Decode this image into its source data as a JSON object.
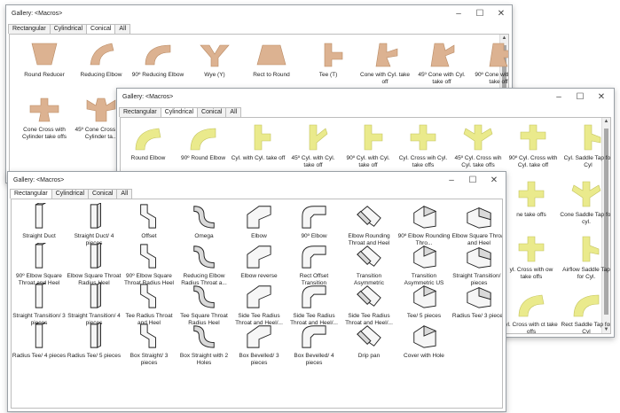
{
  "colors": {
    "conical": "#dcb291",
    "conical_dark": "#b98a63",
    "cylindrical": "#eaea8c",
    "cylindrical_dark": "#c3c35e",
    "accent_ink": "#222222"
  },
  "controls": {
    "minimize": "–",
    "maximize": "☐",
    "close": "✕",
    "scroll_up": "▲",
    "scroll_down": "▼"
  },
  "window1": {
    "title": "Gallery: <Macros>",
    "tabs": [
      "Rectangular",
      "Cylindrical",
      "Conical",
      "All"
    ],
    "active_tab": 2,
    "items": [
      {
        "label": "Round Reducer",
        "icon": "round-reducer-icon"
      },
      {
        "label": "Reducing Elbow",
        "icon": "reducing-elbow-icon"
      },
      {
        "label": "90º Reducing Elbow",
        "icon": "reducing-elbow-90-icon"
      },
      {
        "label": "Wye (Y)",
        "icon": "wye-icon"
      },
      {
        "label": "Rect to Round",
        "icon": "rect-to-round-icon"
      },
      {
        "label": "Tee (T)",
        "icon": "tee-icon"
      },
      {
        "label": "Cone with Cyl. take off",
        "icon": "cone-cyl-takeoff-icon"
      },
      {
        "label": "45º Cone with Cyl. take off",
        "icon": "cone-45-takeoff-icon"
      },
      {
        "label": "90º Cone with Cyl. take off",
        "icon": "cone-90-takeoff-icon"
      },
      {
        "label": "Cone Cross with Cylinder take offs",
        "icon": "cone-cross-icon"
      },
      {
        "label": "45º Cone Cross with Cylinder ta...",
        "icon": "cone-cross-45-icon"
      },
      {
        "label": "",
        "icon": "cone-partial-icon"
      },
      {
        "label": "",
        "icon": "cone-partial-icon"
      }
    ]
  },
  "window2": {
    "title": "Gallery: <Macros>",
    "tabs": [
      "Rectangular",
      "Cylindrical",
      "Conical",
      "All"
    ],
    "active_tab": 1,
    "items": [
      {
        "label": "Round Elbow",
        "icon": "round-elbow-icon"
      },
      {
        "label": "90º Round Elbow",
        "icon": "round-elbow-90-icon"
      },
      {
        "label": "Cyl. with Cyl. take off",
        "icon": "cyl-takeoff-icon"
      },
      {
        "label": "45º Cyl. with Cyl. take off",
        "icon": "cyl-45-takeoff-icon"
      },
      {
        "label": "90º Cyl. with Cyl. take off",
        "icon": "cyl-90-takeoff-icon"
      },
      {
        "label": "Cyl. Cross wih Cyl. take offs",
        "icon": "cyl-cross-icon"
      },
      {
        "label": "45º Cyl. Cross wih Cyl. take offs",
        "icon": "cyl-cross-45-icon"
      },
      {
        "label": "90º Cyl. Cross with Cyl. take off",
        "icon": "cyl-cross-90-icon"
      },
      {
        "label": "Cyl. Saddle Tap for Cyl",
        "icon": "saddle-tap-icon"
      }
    ],
    "side_items": [
      {
        "label": "ne take offs",
        "icon": "cyl-cross-side-icon"
      },
      {
        "label": "Cone Saddle Tap for cyl.",
        "icon": "cone-saddle-icon"
      },
      {
        "label": "yl. Cross with ow take offs",
        "icon": "cyl-cross-side2-icon"
      },
      {
        "label": "Airflow Saddle Tap for Cyl.",
        "icon": "airflow-saddle-icon"
      },
      {
        "label": "yl. Cross with ct take offs",
        "icon": "cyl-cross-side3-icon"
      },
      {
        "label": "Rect Saddle Tap for Cyl",
        "icon": "rect-saddle-icon"
      }
    ]
  },
  "window3": {
    "title": "Gallery: <Macros>",
    "tabs": [
      "Rectangular",
      "Cylindrical",
      "Conical",
      "All"
    ],
    "active_tab": 0,
    "items": [
      {
        "label": "Straight Duct",
        "icon": "straight-duct-icon"
      },
      {
        "label": "Straight Duct/ 4 pieces",
        "icon": "straight-duct-4-icon"
      },
      {
        "label": "Offset",
        "icon": "offset-icon"
      },
      {
        "label": "Omega",
        "icon": "omega-icon"
      },
      {
        "label": "Elbow",
        "icon": "elbow-icon"
      },
      {
        "label": "90º Elbow",
        "icon": "elbow-90-icon"
      },
      {
        "label": "Elbow Rounding Throat and Heel",
        "icon": "elbow-rounding-icon"
      },
      {
        "label": "90º Elbow Rounding Thro...",
        "icon": "elbow-rounding-90-icon"
      },
      {
        "label": "Elbow Square Throat and Heel",
        "icon": "elbow-square-icon"
      },
      {
        "label": "90º Elbow Square Throat and Heel",
        "icon": "elbow-square-90-icon"
      },
      {
        "label": "Elbow Square Throat Radius Heel",
        "icon": "elbow-square-radius-icon"
      },
      {
        "label": "90º Elbow Square Throat Radius Heel",
        "icon": "elbow-square-radius-90-icon"
      },
      {
        "label": "Reducing Elbow Radius Throat a...",
        "icon": "reducing-elbow-radius-icon"
      },
      {
        "label": "Elbow reverse",
        "icon": "elbow-reverse-icon"
      },
      {
        "label": "Rect Offset Transition",
        "icon": "rect-offset-transition-icon"
      },
      {
        "label": "Transition Asymmetric",
        "icon": "transition-asym-icon"
      },
      {
        "label": "Transition Asymmetric US",
        "icon": "transition-asym-us-icon"
      },
      {
        "label": "Straight Transition/ 2 pieces",
        "icon": "straight-transition-2-icon"
      },
      {
        "label": "Straight Transition/ 3 pieces",
        "icon": "straight-transition-3-icon"
      },
      {
        "label": "Straight Transition/ 4 pieces",
        "icon": "straight-transition-4-icon"
      },
      {
        "label": "Tee Radius Throat and Heel",
        "icon": "tee-radius-icon"
      },
      {
        "label": "Tee Square Throat Radius Heel",
        "icon": "tee-square-icon"
      },
      {
        "label": "Side Tee Radius Throat and Heel/...",
        "icon": "side-tee-radius-icon"
      },
      {
        "label": "Side Tee Radius Throat and Heel/...",
        "icon": "side-tee-radius-2-icon"
      },
      {
        "label": "Side Tee Radius Throat and Heel/...",
        "icon": "side-tee-radius-3-icon"
      },
      {
        "label": "Tee/ 5 pieces",
        "icon": "tee-5-icon"
      },
      {
        "label": "Radius Tee/ 3 pieces",
        "icon": "radius-tee-3-icon"
      },
      {
        "label": "Radius Tee/ 4 pieces",
        "icon": "radius-tee-4-icon"
      },
      {
        "label": "Radius Tee/ 5 pieces",
        "icon": "radius-tee-5-icon"
      },
      {
        "label": "Box Straight/ 3 pieces",
        "icon": "box-straight-3-icon"
      },
      {
        "label": "Box Straight with 2 Holes",
        "icon": "box-straight-holes-icon"
      },
      {
        "label": "Box Bevelled/ 3 pieces",
        "icon": "box-bevelled-3-icon"
      },
      {
        "label": "Box Bevelled/ 4 pieces",
        "icon": "box-bevelled-4-icon"
      },
      {
        "label": "Drip pan",
        "icon": "drip-pan-icon"
      },
      {
        "label": "Cover with Hole",
        "icon": "cover-hole-icon"
      }
    ]
  }
}
